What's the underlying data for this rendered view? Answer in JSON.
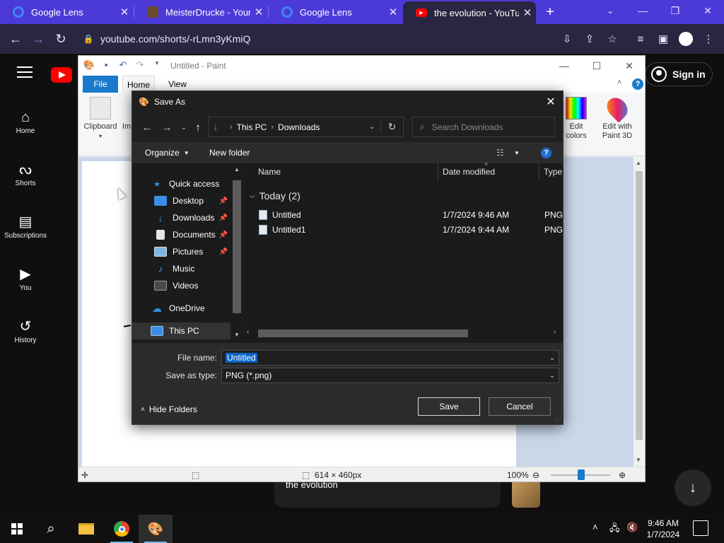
{
  "browser": {
    "tabs": [
      {
        "title": "Google Lens",
        "favicon_color": "#4285f4"
      },
      {
        "title": "MeisterDrucke - Your",
        "favicon_color": "#6b4a2a"
      },
      {
        "title": "Google Lens",
        "favicon_color": "#4285f4"
      },
      {
        "title": "the evolution - YouTul",
        "favicon_color": "#ff0000"
      }
    ],
    "new_tab_icon": "plus-icon",
    "url": "youtube.com/shorts/-rLmn3yKmiQ",
    "accent_color": "#4b3ad7"
  },
  "youtube": {
    "nav": [
      {
        "label": "Home",
        "icon": "home-icon"
      },
      {
        "label": "Shorts",
        "icon": "shorts-icon"
      },
      {
        "label": "Subscriptions",
        "icon": "subscriptions-icon"
      },
      {
        "label": "You",
        "icon": "you-icon"
      },
      {
        "label": "History",
        "icon": "history-icon"
      }
    ],
    "sign_in": "Sign in",
    "short_title": "the evolution"
  },
  "paint": {
    "title": "Untitled - Paint",
    "tabs": [
      "File",
      "Home",
      "View"
    ],
    "groups": {
      "clipboard": "Clipboard",
      "image": "Im",
      "edit_colors": "Edit colors",
      "edit_paint3d": "Edit with Paint 3D"
    },
    "status": {
      "dimensions": "614 × 460px",
      "zoom": "100%"
    }
  },
  "dialog": {
    "title": "Save As",
    "path": [
      "This PC",
      "Downloads"
    ],
    "search_placeholder": "Search Downloads",
    "commands": {
      "organize": "Organize",
      "new_folder": "New folder"
    },
    "nav_items": [
      {
        "label": "Quick access",
        "icon": "star-icon",
        "pinned": false
      },
      {
        "label": "Desktop",
        "icon": "desktop-icon",
        "pinned": true
      },
      {
        "label": "Downloads",
        "icon": "download-icon",
        "pinned": true
      },
      {
        "label": "Documents",
        "icon": "document-icon",
        "pinned": true
      },
      {
        "label": "Pictures",
        "icon": "pictures-icon",
        "pinned": true
      },
      {
        "label": "Music",
        "icon": "music-icon",
        "pinned": false
      },
      {
        "label": "Videos",
        "icon": "videos-icon",
        "pinned": false
      },
      {
        "label": "OneDrive",
        "icon": "cloud-icon",
        "pinned": false
      },
      {
        "label": "This PC",
        "icon": "computer-icon",
        "pinned": false
      }
    ],
    "columns": [
      "Name",
      "Date modified",
      "Type"
    ],
    "group_header": "Today (2)",
    "files": [
      {
        "name": "Untitled",
        "date": "1/7/2024 9:46 AM",
        "type": "PNG"
      },
      {
        "name": "Untitled1",
        "date": "1/7/2024 9:44 AM",
        "type": "PNG"
      }
    ],
    "file_name_label": "File name:",
    "file_name_value": "Untitled",
    "save_type_label": "Save as type:",
    "save_type_value": "PNG (*.png)",
    "hide_folders": "Hide Folders",
    "save": "Save",
    "cancel": "Cancel"
  },
  "taskbar": {
    "time": "9:46 AM",
    "date": "1/7/2024"
  }
}
